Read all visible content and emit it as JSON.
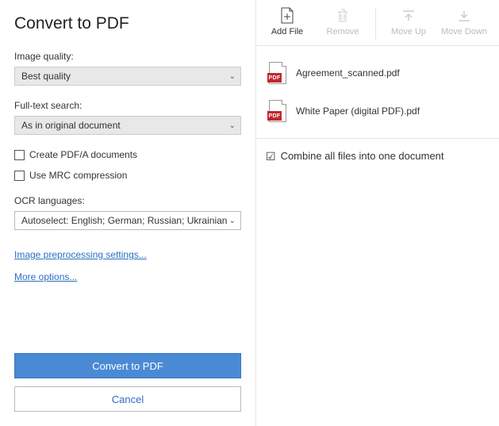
{
  "title": "Convert to PDF",
  "imageQuality": {
    "label": "Image quality:",
    "value": "Best quality"
  },
  "fullTextSearch": {
    "label": "Full-text search:",
    "value": "As in original document"
  },
  "checkboxes": {
    "pdfa": "Create PDF/A documents",
    "mrc": "Use MRC compression"
  },
  "ocrLanguages": {
    "label": "OCR languages:",
    "value": "Autoselect: English; German; Russian; Ukrainian"
  },
  "links": {
    "preprocessing": "Image preprocessing settings...",
    "more": "More options..."
  },
  "buttons": {
    "convert": "Convert to PDF",
    "cancel": "Cancel"
  },
  "toolbar": {
    "addFile": "Add File",
    "remove": "Remove",
    "moveUp": "Move Up",
    "moveDown": "Move Down"
  },
  "files": [
    {
      "name": "Agreement_scanned.pdf",
      "badge": "PDF"
    },
    {
      "name": "White Paper (digital PDF).pdf",
      "badge": "PDF"
    }
  ],
  "combine": {
    "label": "Combine all files into one document",
    "checked": true
  }
}
